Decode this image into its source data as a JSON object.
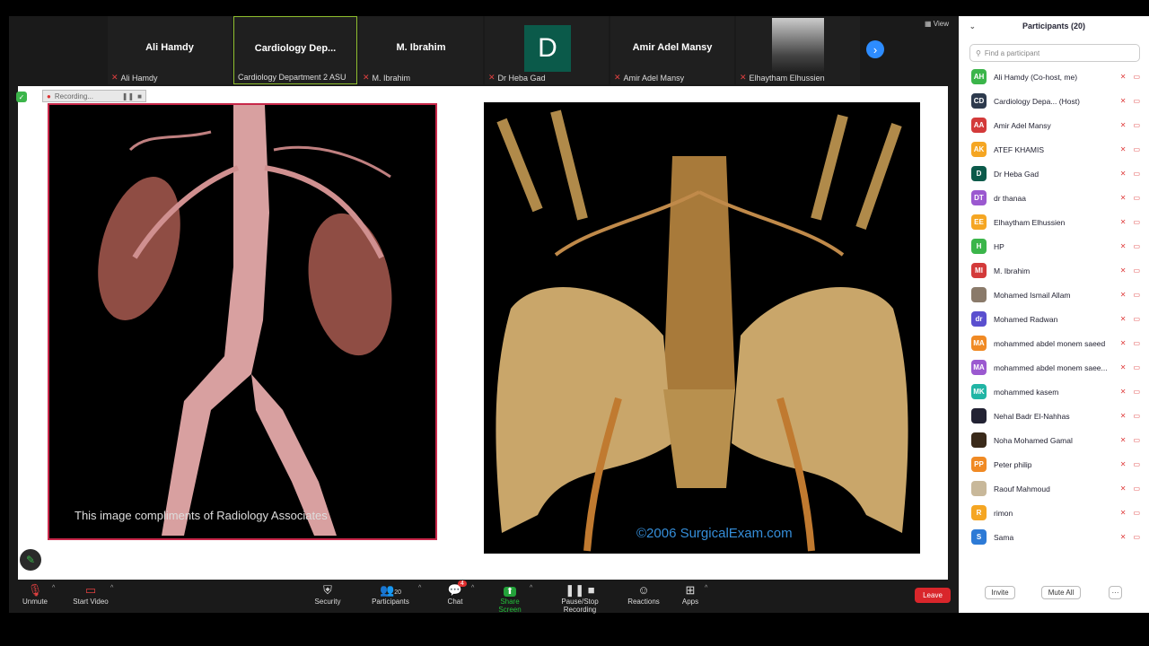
{
  "strip": {
    "view_label": "View",
    "tiles": [
      {
        "name": "Ali Hamdy",
        "label": "Ali Hamdy"
      },
      {
        "name": "Cardiology  Dep...",
        "label": "Cardiology Department 2 ASU"
      },
      {
        "name": "M. Ibrahim",
        "label": "M. Ibrahim"
      },
      {
        "name": "D",
        "label": "Dr Heba Gad"
      },
      {
        "name": "Amir Adel Mansy",
        "label": "Amir Adel Mansy"
      },
      {
        "name": "",
        "label": "Elhaytham Elhussien"
      }
    ]
  },
  "share": {
    "recording_label": "Recording...",
    "caption_left": "This image compliments of Radiology Associates",
    "caption_right": "©2006 SurgicalExam.com"
  },
  "toolbar": {
    "unmute": "Unmute",
    "start_video": "Start Video",
    "security": "Security",
    "participants": "Participants",
    "participants_count": "20",
    "chat": "Chat",
    "chat_badge": "4",
    "share_screen": "Share Screen",
    "pause_stop": "Pause/Stop Recording",
    "reactions": "Reactions",
    "apps": "Apps",
    "leave": "Leave"
  },
  "panel": {
    "title": "Participants (20)",
    "search_placeholder": "Find a participant",
    "invite": "Invite",
    "mute_all": "Mute All",
    "more": "···",
    "participants": [
      {
        "initials": "AH",
        "name": "Ali Hamdy (Co-host, me)",
        "color": "#3bb54a"
      },
      {
        "initials": "CD",
        "name": "Cardiology Depa...  (Host)",
        "color": "#2d3a4d"
      },
      {
        "initials": "AA",
        "name": "Amir Adel Mansy",
        "color": "#d33a3a"
      },
      {
        "initials": "AK",
        "name": "ATEF KHAMIS",
        "color": "#f5a623"
      },
      {
        "initials": "D",
        "name": "Dr Heba Gad",
        "color": "#0b5a4a"
      },
      {
        "initials": "DT",
        "name": "dr thanaa",
        "color": "#9b59d0"
      },
      {
        "initials": "EE",
        "name": "Elhaytham Elhussien",
        "color": "#f5a623"
      },
      {
        "initials": "H",
        "name": "HP",
        "color": "#3bb54a"
      },
      {
        "initials": "MI",
        "name": "M. Ibrahim",
        "color": "#d33a3a"
      },
      {
        "initials": "",
        "name": "Mohamed Ismail Allam",
        "color": "#8a7a6a"
      },
      {
        "initials": "dr",
        "name": "Mohamed Radwan",
        "color": "#5a4fcf"
      },
      {
        "initials": "MA",
        "name": "mohammed abdel monem saeed",
        "color": "#f08a24"
      },
      {
        "initials": "MA",
        "name": "mohammed abdel monem saee...",
        "color": "#9b59d0"
      },
      {
        "initials": "MK",
        "name": "mohammed kasem",
        "color": "#21b5a5"
      },
      {
        "initials": "",
        "name": "Nehal Badr El-Nahhas",
        "color": "#223"
      },
      {
        "initials": "",
        "name": "Noha Mohamed Gamal",
        "color": "#3a2a1a"
      },
      {
        "initials": "PP",
        "name": "Peter philip",
        "color": "#f08a24"
      },
      {
        "initials": "",
        "name": "Raouf Mahmoud",
        "color": "#c8b89a"
      },
      {
        "initials": "R",
        "name": "rimon",
        "color": "#f5a623"
      },
      {
        "initials": "S",
        "name": "Sama",
        "color": "#2d7ad6"
      }
    ]
  }
}
